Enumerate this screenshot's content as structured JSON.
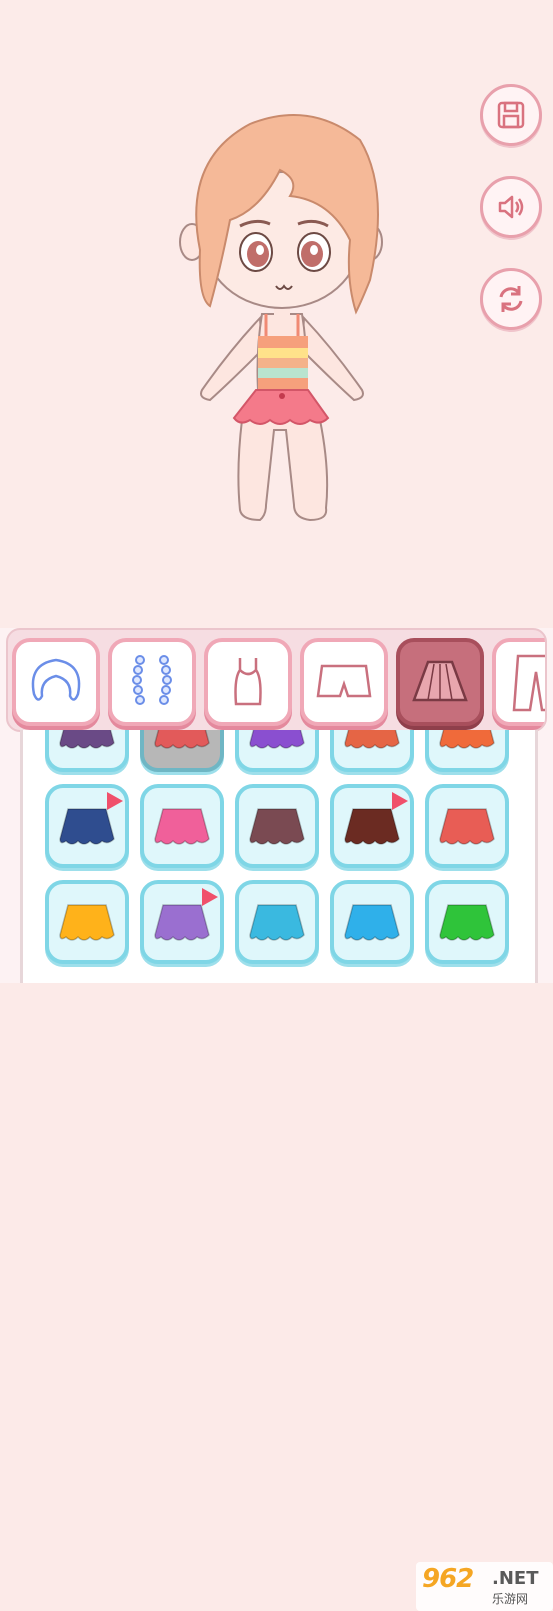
{
  "side_buttons": [
    {
      "name": "save-button",
      "icon": "floppy-disk-icon"
    },
    {
      "name": "sound-button",
      "icon": "speaker-icon"
    },
    {
      "name": "refresh-button",
      "icon": "refresh-icon"
    }
  ],
  "categories": [
    {
      "name": "category-hair",
      "icon": "hair-icon",
      "active": false
    },
    {
      "name": "category-accessory",
      "icon": "bead-necklace-icon",
      "active": false
    },
    {
      "name": "category-top",
      "icon": "tank-top-icon",
      "active": false
    },
    {
      "name": "category-shorts",
      "icon": "shorts-icon",
      "active": false
    },
    {
      "name": "category-skirt",
      "icon": "skirt-icon",
      "active": true
    },
    {
      "name": "category-pants",
      "icon": "pants-icon",
      "active": false
    }
  ],
  "items_row0": [
    {
      "color": "#6a4a86",
      "new": false
    },
    {
      "color": "#e25a5a",
      "new": false,
      "selected": true
    },
    {
      "color": "#8a4fd0",
      "new": false
    },
    {
      "color": "#e56545",
      "new": false
    },
    {
      "color": "#f06a3a",
      "new": false
    }
  ],
  "items_row1": [
    {
      "color": "#2f4d8f",
      "new": true
    },
    {
      "color": "#f0609a",
      "new": false
    },
    {
      "color": "#7a4a52",
      "new": false
    },
    {
      "color": "#6b2b22",
      "new": true
    },
    {
      "color": "#e85d55",
      "new": false
    }
  ],
  "items_row2": [
    {
      "color": "#ffb21a",
      "new": false
    },
    {
      "color": "#9a6fd0",
      "new": true
    },
    {
      "color": "#3ab9e0",
      "new": false
    },
    {
      "color": "#2fb0ea",
      "new": false
    },
    {
      "color": "#2fc43a",
      "new": false
    }
  ],
  "watermark": {
    "logo": "962",
    "net": ".NET",
    "sub": "乐游网"
  }
}
